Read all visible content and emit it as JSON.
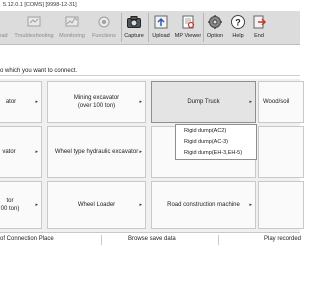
{
  "window": {
    "title": "5.12.0.1 [COMS] [9998-12-31]"
  },
  "toolbar": {
    "items": [
      {
        "label": "oad",
        "enabled": false
      },
      {
        "label": "Troubleshooting",
        "enabled": false
      },
      {
        "label": "Monitoring",
        "enabled": false
      },
      {
        "label": "Functions",
        "enabled": false
      },
      {
        "label": "Capture",
        "enabled": true
      },
      {
        "label": "Upload",
        "enabled": true
      },
      {
        "label": "MP Viewer",
        "enabled": true
      },
      {
        "label": "Option",
        "enabled": true
      },
      {
        "label": "Help",
        "enabled": true
      },
      {
        "label": "End",
        "enabled": true
      }
    ]
  },
  "instruction": "o which you want to connect.",
  "grid": {
    "rows": [
      [
        {
          "label": "ator",
          "arrow": "▸"
        },
        {
          "label": "Mining excavator\n(over 100 ton)",
          "arrow": "▸"
        },
        {
          "label": "Dump Truck",
          "arrow": "▸",
          "selected": true
        },
        {
          "label": "Wood/soil",
          "arrow": "▸"
        }
      ],
      [
        {
          "label": "vator",
          "arrow": "▸"
        },
        {
          "label": "Wheel type hydraulic excavator",
          "arrow": "▸"
        },
        {
          "label": "",
          "arrow": ""
        },
        {
          "label": "",
          "arrow": ""
        }
      ],
      [
        {
          "label": "tor\n00 ton)",
          "arrow": "▸"
        },
        {
          "label": "Wheel Loader",
          "arrow": "▸"
        },
        {
          "label": "Road construction machine",
          "arrow": "▸"
        },
        {
          "label": "",
          "arrow": ""
        }
      ]
    ]
  },
  "dropdown": {
    "items": [
      "Rigid dump(AC2)",
      "Rigid dump(AC-3)",
      "Rigid dump(EH-3,EH-5)"
    ]
  },
  "bottom_bar": {
    "left": "of Connection Place",
    "middle": "Browse save data",
    "right": "Play recorded"
  },
  "colors": {
    "toolbar_bg": "#dcdcdc",
    "grid_bg": "#f0f0f0",
    "selected_cell": "#e4e4e4",
    "end_icon": "#c0392b"
  }
}
